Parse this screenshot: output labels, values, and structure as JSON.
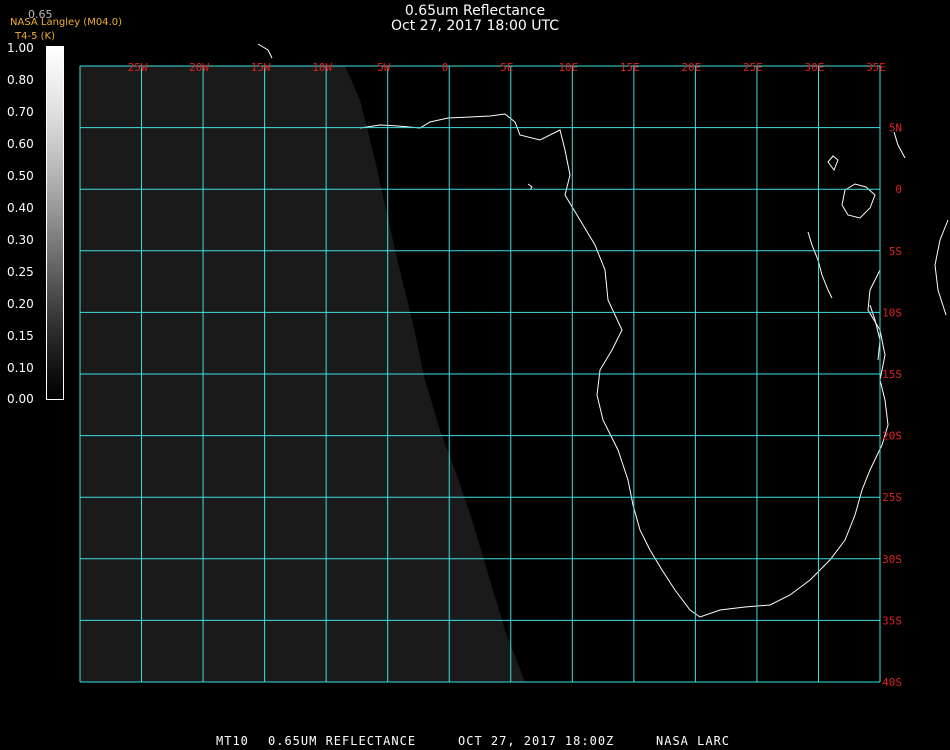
{
  "header": {
    "title": "0.65um Reflectance",
    "subtitle": "Oct 27, 2017 18:00 UTC",
    "agency_line": "NASA Langley (M04.0)",
    "sub_line": "T4-5 (K)",
    "overlap_line": "0.65"
  },
  "colorbar": {
    "labels": [
      "1.00",
      "0.80",
      "0.70",
      "0.60",
      "0.50",
      "0.40",
      "0.30",
      "0.25",
      "0.20",
      "0.15",
      "0.10",
      "0.00"
    ]
  },
  "map": {
    "lon_labels": [
      "25W",
      "20W",
      "15W",
      "10W",
      "5W",
      "0",
      "5E",
      "10E",
      "15E",
      "20E",
      "25E",
      "30E",
      "35E"
    ],
    "lat_labels": [
      "5N",
      "0",
      "5S",
      "10S",
      "15S",
      "20S",
      "25S",
      "30S",
      "35S",
      "40S"
    ],
    "grid_color": "#40e0e0",
    "label_color": "#e02020",
    "coast_color": "#ffffff"
  },
  "footer": {
    "product": "MT10",
    "band": "0.65UM REFLECTANCE",
    "datetime": "OCT 27, 2017 18:00Z",
    "source": "NASA LARC"
  }
}
